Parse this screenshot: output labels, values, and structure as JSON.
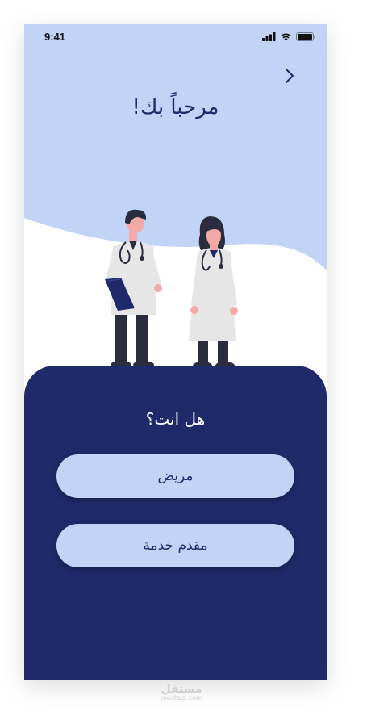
{
  "status_bar": {
    "time": "9:41",
    "icons": [
      "signal-icon",
      "wifi-icon",
      "battery-icon"
    ]
  },
  "header": {
    "back_icon": "chevron-right-icon",
    "title": "مرحباً بك!"
  },
  "illustration": {
    "subject": "two-doctors-icon"
  },
  "bottom_panel": {
    "question": "هل انت؟",
    "options": [
      {
        "label": "مريض"
      },
      {
        "label": "مقدم خدمة"
      }
    ]
  },
  "watermark": {
    "main": "مستقل",
    "sub": "mostaql.com"
  },
  "colors": {
    "background_light_blue": "#c2d4f6",
    "panel_navy": "#1f2a6a",
    "title_navy": "#1e2a6b",
    "button_fill": "#c2d4f6",
    "button_text": "#1f2a6a"
  }
}
